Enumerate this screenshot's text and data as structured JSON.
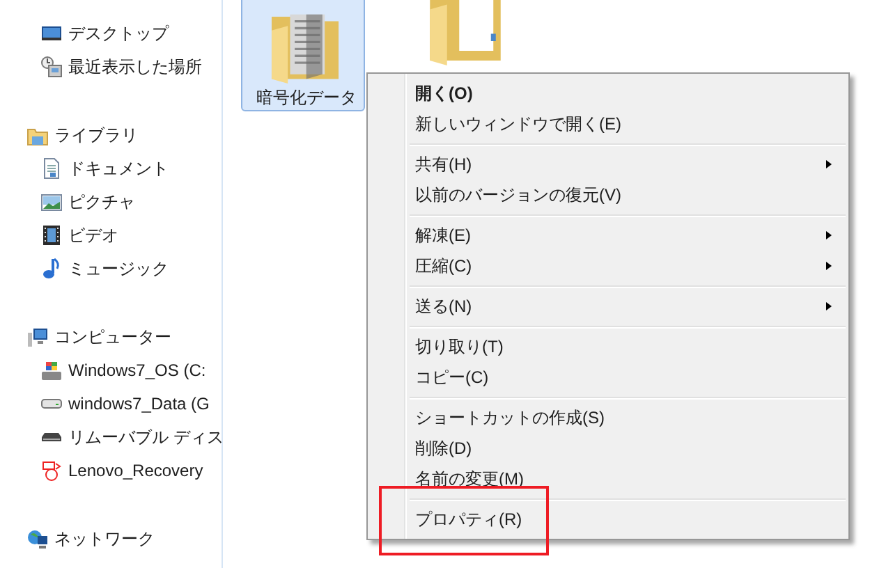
{
  "sidebar": {
    "sections": [
      {
        "children": [
          {
            "label": "デスクトップ"
          },
          {
            "label": "最近表示した場所"
          }
        ]
      },
      {
        "label": "ライブラリ",
        "children": [
          {
            "label": "ドキュメント"
          },
          {
            "label": "ピクチャ"
          },
          {
            "label": "ビデオ"
          },
          {
            "label": "ミュージック"
          }
        ]
      },
      {
        "label": "コンピューター",
        "children": [
          {
            "label": "Windows7_OS (C:"
          },
          {
            "label": "windows7_Data (G"
          },
          {
            "label": "リムーバブル ディス"
          },
          {
            "label": "Lenovo_Recovery"
          }
        ]
      },
      {
        "label": "ネットワーク"
      }
    ]
  },
  "folders": [
    {
      "label": "暗号化データ",
      "selected": true
    },
    {
      "selected": false
    }
  ],
  "context_menu": {
    "groups": [
      [
        {
          "label": "開く(O)",
          "default": true,
          "submenu": false
        },
        {
          "label": "新しいウィンドウで開く(E)",
          "default": false,
          "submenu": false
        }
      ],
      [
        {
          "label": "共有(H)",
          "default": false,
          "submenu": true
        },
        {
          "label": "以前のバージョンの復元(V)",
          "default": false,
          "submenu": false
        }
      ],
      [
        {
          "label": "解凍(E)",
          "default": false,
          "submenu": true
        },
        {
          "label": "圧縮(C)",
          "default": false,
          "submenu": true
        }
      ],
      [
        {
          "label": "送る(N)",
          "default": false,
          "submenu": true
        }
      ],
      [
        {
          "label": "切り取り(T)",
          "default": false,
          "submenu": false
        },
        {
          "label": "コピー(C)",
          "default": false,
          "submenu": false
        }
      ],
      [
        {
          "label": "ショートカットの作成(S)",
          "default": false,
          "submenu": false
        },
        {
          "label": "削除(D)",
          "default": false,
          "submenu": false
        },
        {
          "label": "名前の変更(M)",
          "default": false,
          "submenu": false
        }
      ],
      [
        {
          "label": "プロパティ(R)",
          "default": false,
          "submenu": false
        }
      ]
    ]
  }
}
